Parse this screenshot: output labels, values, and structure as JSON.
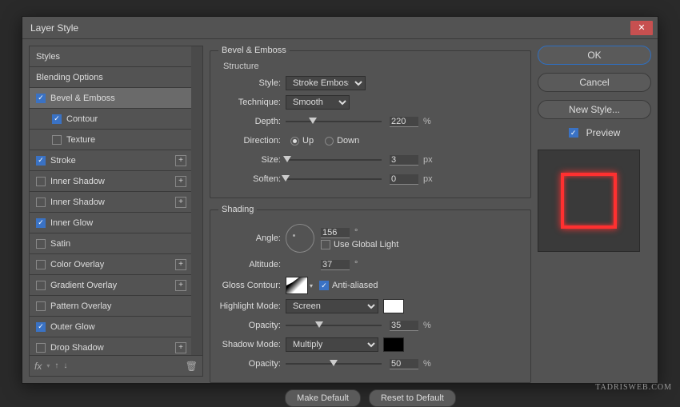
{
  "title": "Layer Style",
  "styles_panel": {
    "header": "Styles",
    "items": [
      {
        "label": "Blending Options",
        "checked": null
      },
      {
        "label": "Bevel & Emboss",
        "checked": true,
        "selected": true
      },
      {
        "label": "Contour",
        "checked": true,
        "indent": true
      },
      {
        "label": "Texture",
        "checked": false,
        "indent": true
      },
      {
        "label": "Stroke",
        "checked": true,
        "plus": true
      },
      {
        "label": "Inner Shadow",
        "checked": false,
        "plus": true
      },
      {
        "label": "Inner Shadow",
        "checked": false,
        "plus": true
      },
      {
        "label": "Inner Glow",
        "checked": true
      },
      {
        "label": "Satin",
        "checked": false
      },
      {
        "label": "Color Overlay",
        "checked": false,
        "plus": true
      },
      {
        "label": "Gradient Overlay",
        "checked": false,
        "plus": true
      },
      {
        "label": "Pattern Overlay",
        "checked": false
      },
      {
        "label": "Outer Glow",
        "checked": true
      },
      {
        "label": "Drop Shadow",
        "checked": false,
        "plus": true
      }
    ],
    "footer_fx": "fx"
  },
  "bevel": {
    "legend": "Bevel & Emboss",
    "structure_label": "Structure",
    "style_label": "Style:",
    "style_value": "Stroke Emboss",
    "technique_label": "Technique:",
    "technique_value": "Smooth",
    "depth_label": "Depth:",
    "depth_value": "220",
    "depth_unit": "%",
    "direction_label": "Direction:",
    "direction_up": "Up",
    "direction_down": "Down",
    "size_label": "Size:",
    "size_value": "3",
    "size_unit": "px",
    "soften_label": "Soften:",
    "soften_value": "0",
    "soften_unit": "px"
  },
  "shading": {
    "legend": "Shading",
    "angle_label": "Angle:",
    "angle_value": "156",
    "angle_unit": "°",
    "global_light": "Use Global Light",
    "altitude_label": "Altitude:",
    "altitude_value": "37",
    "altitude_unit": "°",
    "gloss_label": "Gloss Contour:",
    "antialiased": "Anti-aliased",
    "highlight_label": "Highlight Mode:",
    "highlight_value": "Screen",
    "highlight_color": "#ffffff",
    "h_opacity_label": "Opacity:",
    "h_opacity_value": "35",
    "h_opacity_unit": "%",
    "shadow_label": "Shadow Mode:",
    "shadow_value": "Multiply",
    "shadow_color": "#000000",
    "s_opacity_label": "Opacity:",
    "s_opacity_value": "50",
    "s_opacity_unit": "%"
  },
  "buttons": {
    "make_default": "Make Default",
    "reset_default": "Reset to Default",
    "ok": "OK",
    "cancel": "Cancel",
    "new_style": "New Style...",
    "preview": "Preview"
  },
  "watermark": "TADRISWEB.COM"
}
